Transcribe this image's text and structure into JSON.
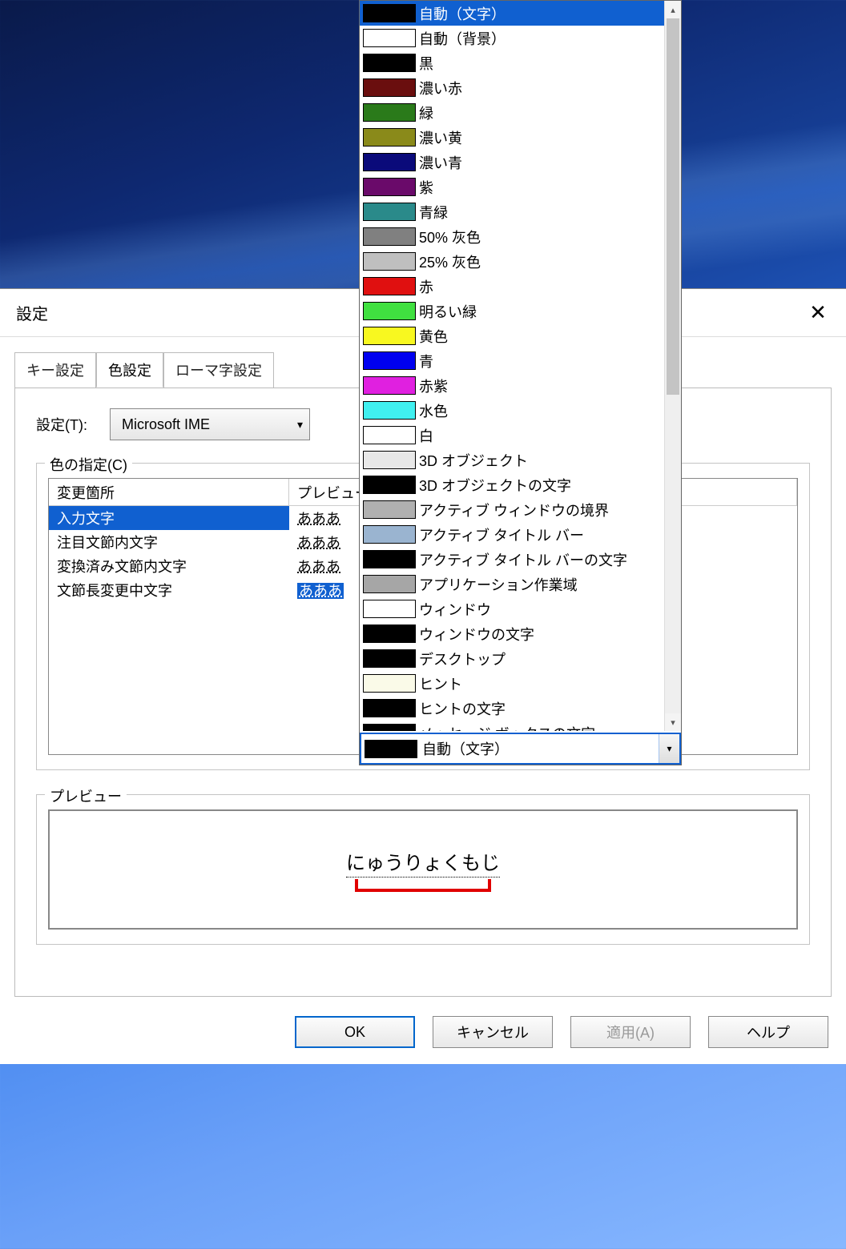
{
  "dialog": {
    "title": "設定",
    "tabs": {
      "key": "キー設定",
      "color": "色設定",
      "romaji": "ローマ字設定"
    },
    "settings_label": "設定(T):",
    "ime_value": "Microsoft IME",
    "color_spec_group": "色の指定(C)",
    "list": {
      "header_location": "変更箇所",
      "header_preview": "プレビュー",
      "rows": [
        {
          "name": "入力文字",
          "preview": "あああ"
        },
        {
          "name": "注目文節内文字",
          "preview": "あああ"
        },
        {
          "name": "変換済み文節内文字",
          "preview": "あああ"
        },
        {
          "name": "文節長変更中文字",
          "preview": "あああ"
        }
      ]
    },
    "preview_group": "プレビュー",
    "preview_sample": "にゅうりょくもじ",
    "buttons": {
      "ok": "OK",
      "cancel": "キャンセル",
      "apply": "適用(A)",
      "help": "ヘルプ"
    }
  },
  "color_dropdown": {
    "options": [
      {
        "label": "自動（文字）",
        "color": "#000000"
      },
      {
        "label": "自動（背景）",
        "color": "#ffffff"
      },
      {
        "label": "黒",
        "color": "#000000"
      },
      {
        "label": "濃い赤",
        "color": "#6a0e0e"
      },
      {
        "label": "緑",
        "color": "#2a7a1a"
      },
      {
        "label": "濃い黄",
        "color": "#8a8a1a"
      },
      {
        "label": "濃い青",
        "color": "#0a0a7a"
      },
      {
        "label": "紫",
        "color": "#6a0a6a"
      },
      {
        "label": "青緑",
        "color": "#2a8a8a"
      },
      {
        "label": "50% 灰色",
        "color": "#808080"
      },
      {
        "label": "25% 灰色",
        "color": "#bfbfbf"
      },
      {
        "label": "赤",
        "color": "#e01010"
      },
      {
        "label": "明るい緑",
        "color": "#40e040"
      },
      {
        "label": "黄色",
        "color": "#f8f820"
      },
      {
        "label": "青",
        "color": "#0000f0"
      },
      {
        "label": "赤紫",
        "color": "#e020e0"
      },
      {
        "label": "水色",
        "color": "#40f0f0"
      },
      {
        "label": "白",
        "color": "#ffffff"
      },
      {
        "label": "3D オブジェクト",
        "color": "#e8e8e8"
      },
      {
        "label": "3D オブジェクトの文字",
        "color": "#000000"
      },
      {
        "label": "アクティブ ウィンドウの境界",
        "color": "#b0b0b0"
      },
      {
        "label": "アクティブ タイトル バー",
        "color": "#9ab4d0"
      },
      {
        "label": "アクティブ タイトル バーの文字",
        "color": "#000000"
      },
      {
        "label": "アプリケーション作業域",
        "color": "#a6a6a6"
      },
      {
        "label": "ウィンドウ",
        "color": "#ffffff"
      },
      {
        "label": "ウィンドウの文字",
        "color": "#000000"
      },
      {
        "label": "デスクトップ",
        "color": "#000000"
      },
      {
        "label": "ヒント",
        "color": "#fafae8"
      },
      {
        "label": "ヒントの文字",
        "color": "#000000"
      },
      {
        "label": "メッセージ ボックスの文字",
        "color": "#000000"
      }
    ],
    "current": {
      "label": "自動（文字）",
      "color": "#000000"
    }
  }
}
